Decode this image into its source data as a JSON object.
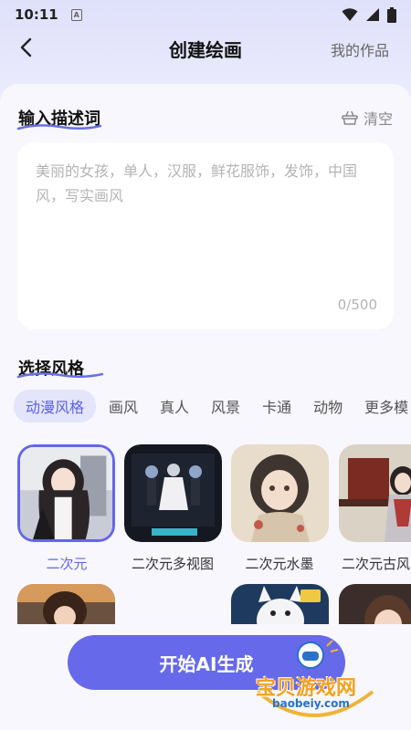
{
  "status_bar": {
    "time": "10:11",
    "badge": "A"
  },
  "nav": {
    "title": "创建绘画",
    "my_works": "我的作品"
  },
  "prompt": {
    "section_title": "输入描述词",
    "clear_label": "清空",
    "placeholder": "美丽的女孩，单人，汉服，鲜花服饰，发饰，中国风，写实画风",
    "counter": "0/500"
  },
  "style": {
    "section_title": "选择风格",
    "tabs": [
      "动漫风格",
      "画风",
      "真人",
      "风景",
      "卡通",
      "动物",
      "更多模"
    ],
    "active_tab_index": 0,
    "cards": [
      {
        "label": "二次元",
        "selected": true
      },
      {
        "label": "二次元多视图",
        "selected": false
      },
      {
        "label": "二次元水墨",
        "selected": false
      },
      {
        "label": "二次元古风",
        "selected": false
      }
    ]
  },
  "start_button": {
    "label": "开始AI生成"
  },
  "watermark": {
    "title": "宝贝游戏网",
    "url": "baobeiy.com"
  },
  "colors": {
    "accent": "#6669ea",
    "active_tab_bg": "#e4e5fb",
    "placeholder": "#b4b4b4"
  }
}
